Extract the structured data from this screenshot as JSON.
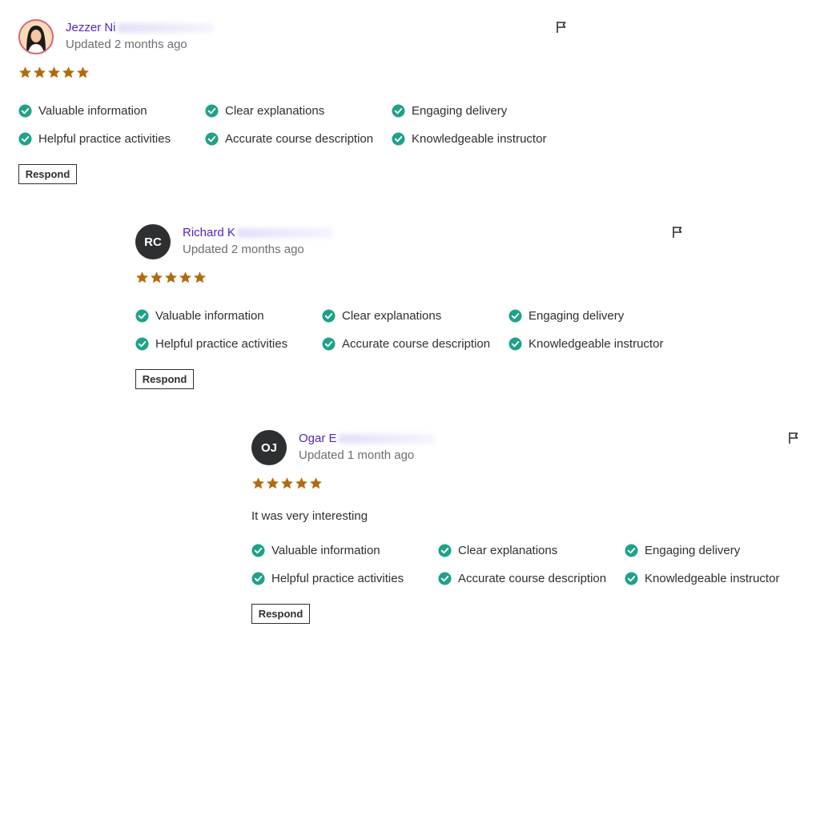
{
  "colors": {
    "accent": "#5022c3",
    "star": "#b4690e",
    "check": "#1ea288",
    "text": "#2d2f31",
    "muted": "#6a6f73"
  },
  "icons": {
    "rating": "star-icon",
    "tag": "check-circle-icon",
    "report": "flag-icon"
  },
  "reviews": [
    {
      "avatar_type": "photo",
      "initials": "",
      "name": "Jezzer Ni",
      "updated": "Updated 2 months ago",
      "rating": 5,
      "comment": "",
      "tags": [
        "Valuable information",
        "Clear explanations",
        "Engaging delivery",
        "Helpful practice activities",
        "Accurate course description",
        "Knowledgeable instructor"
      ],
      "respond_label": "Respond"
    },
    {
      "avatar_type": "initials",
      "initials": "RC",
      "name": "Richard K",
      "updated": "Updated 2 months ago",
      "rating": 5,
      "comment": "",
      "tags": [
        "Valuable information",
        "Clear explanations",
        "Engaging delivery",
        "Helpful practice activities",
        "Accurate course description",
        "Knowledgeable instructor"
      ],
      "respond_label": "Respond"
    },
    {
      "avatar_type": "initials",
      "initials": "OJ",
      "name": "Ogar E",
      "updated": "Updated 1 month ago",
      "rating": 5,
      "comment": "It was very interesting",
      "tags": [
        "Valuable information",
        "Clear explanations",
        "Engaging delivery",
        "Helpful practice activities",
        "Accurate course description",
        "Knowledgeable instructor"
      ],
      "respond_label": "Respond"
    }
  ]
}
